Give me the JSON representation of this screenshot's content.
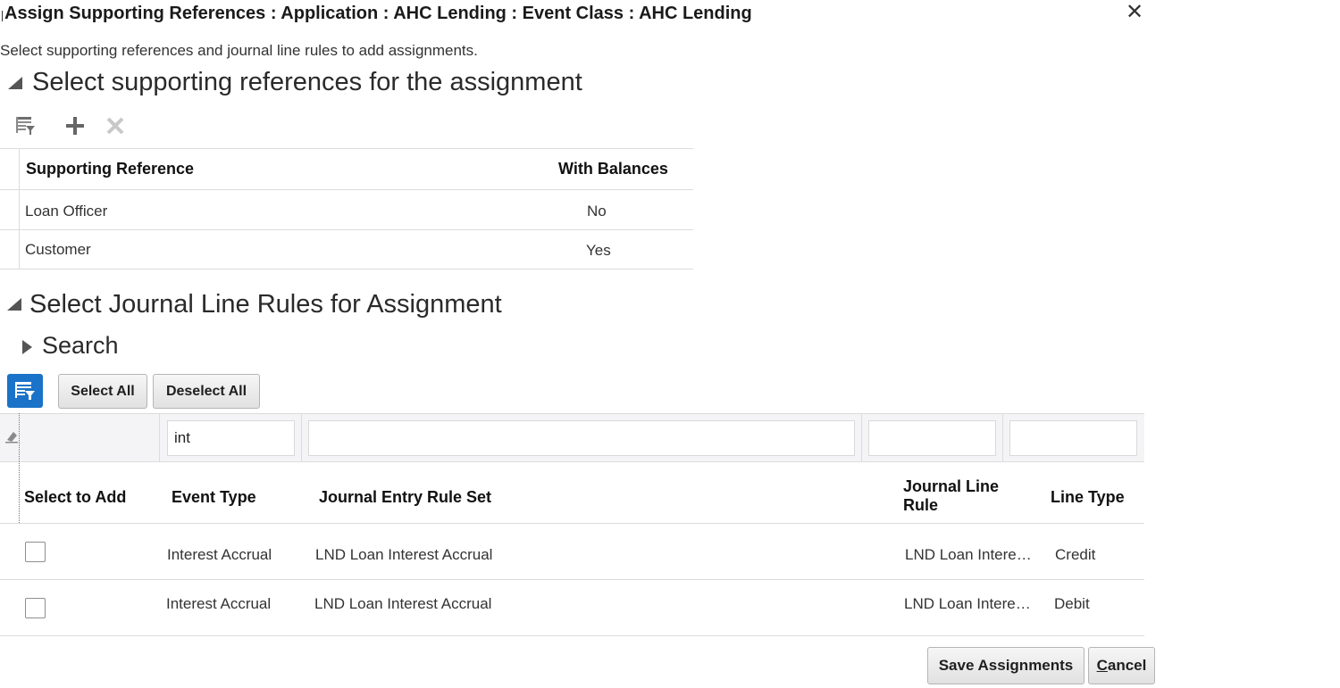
{
  "dialog": {
    "title": "Assign Supporting References : Application : AHC Lending : Event Class : AHC Lending",
    "instructions": "Select supporting references and journal line rules to add assignments."
  },
  "sections": {
    "supporting_refs_heading": "Select supporting references for the assignment",
    "journal_rules_heading": "Select Journal Line Rules for Assignment",
    "search_label": "Search"
  },
  "supporting_refs_table": {
    "columns": {
      "reference": "Supporting Reference",
      "with_balances": "With Balances"
    },
    "rows": [
      {
        "reference": "Loan Officer",
        "with_balances": "No"
      },
      {
        "reference": "Customer",
        "with_balances": "Yes"
      }
    ]
  },
  "buttons": {
    "select_all": "Select All",
    "deselect_all": "Deselect All",
    "save_assignments": "Save Assignments",
    "cancel_initial": "C",
    "cancel_rest": "ancel"
  },
  "filters": {
    "event_type": "int",
    "journal_entry_rule_set": "",
    "journal_line_rule": "",
    "line_type": ""
  },
  "journal_table": {
    "columns": {
      "select": "Select to Add",
      "event_type": "Event Type",
      "rule_set": "Journal Entry Rule Set",
      "line_rule_1": "Journal Line",
      "line_rule_2": "Rule",
      "line_type": "Line Type"
    },
    "rows": [
      {
        "checked": false,
        "event_type": "Interest Accrual",
        "rule_set": "LND Loan Interest Accrual",
        "line_rule": "LND Loan Intere…",
        "line_type": "Credit"
      },
      {
        "checked": false,
        "event_type": "Interest Accrual",
        "rule_set": "LND Loan Interest Accrual",
        "line_rule": "LND Loan Intere…",
        "line_type": "Debit"
      }
    ]
  },
  "icons": {
    "close": "close-icon",
    "detach": "detach-table-icon",
    "add": "plus-icon",
    "delete": "delete-x-icon",
    "query_by_example": "query-by-example-icon",
    "clear_filter": "eraser-icon"
  },
  "colors": {
    "accent": "#1a73c8",
    "text": "#222222",
    "grid": "#dcdcdc"
  }
}
